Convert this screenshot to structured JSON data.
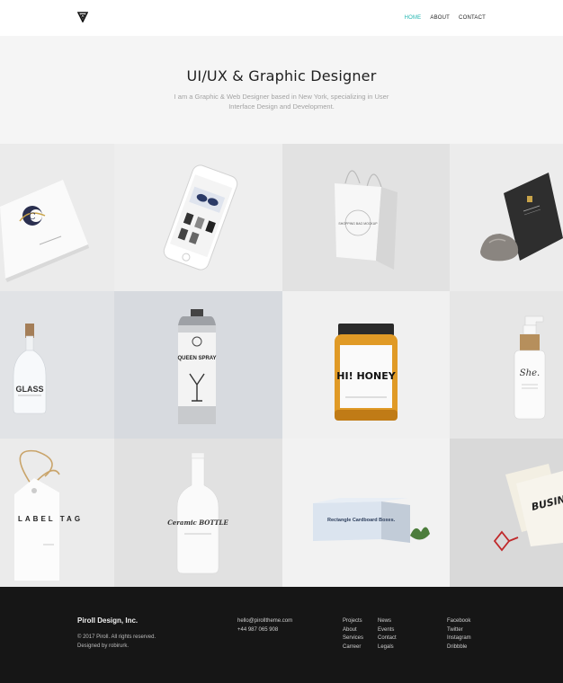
{
  "header": {
    "logo_icon": "triangle-v-logo-icon",
    "nav": [
      {
        "label": "HOME",
        "active": true
      },
      {
        "label": "ABOUT",
        "active": false
      },
      {
        "label": "CONTACT",
        "active": false
      }
    ]
  },
  "hero": {
    "title": "UI/UX & Graphic Designer",
    "subtitle": "I am a Graphic & Web Designer based in New York, specializing in User Interface Design and Development."
  },
  "portfolio": {
    "items": [
      {
        "text": "C"
      },
      {
        "text": ""
      },
      {
        "text": "SHOPPING BAG MOCKUP"
      },
      {
        "text": ""
      },
      {
        "text": "GLASS"
      },
      {
        "text": "QUEEN SPRAY"
      },
      {
        "text": "HI! HONEY"
      },
      {
        "text": "She."
      },
      {
        "text": "LABEL TAG"
      },
      {
        "text": "Ceramic BOTTLE"
      },
      {
        "text": "Rectangle Cardboard Boxes."
      },
      {
        "text": "BUSINESS CARD"
      }
    ]
  },
  "footer": {
    "brand": "Piroll Design, Inc.",
    "copyright": "© 2017 Piroll. All rights reserved.",
    "designed_by": "Designed by robirurk.",
    "email": "hello@pirolltheme.com",
    "phone": "+44 987 065 908",
    "col1": [
      "Projects",
      "About",
      "Services",
      "Carreer"
    ],
    "col2": [
      "News",
      "Events",
      "Contact",
      "Legals"
    ],
    "col3": [
      "Facebook",
      "Twitter",
      "Instagram",
      "Dribbble"
    ]
  },
  "colors": {
    "accent": "#20b6b0",
    "footer_bg": "#161616",
    "hero_bg": "#f5f5f5"
  }
}
